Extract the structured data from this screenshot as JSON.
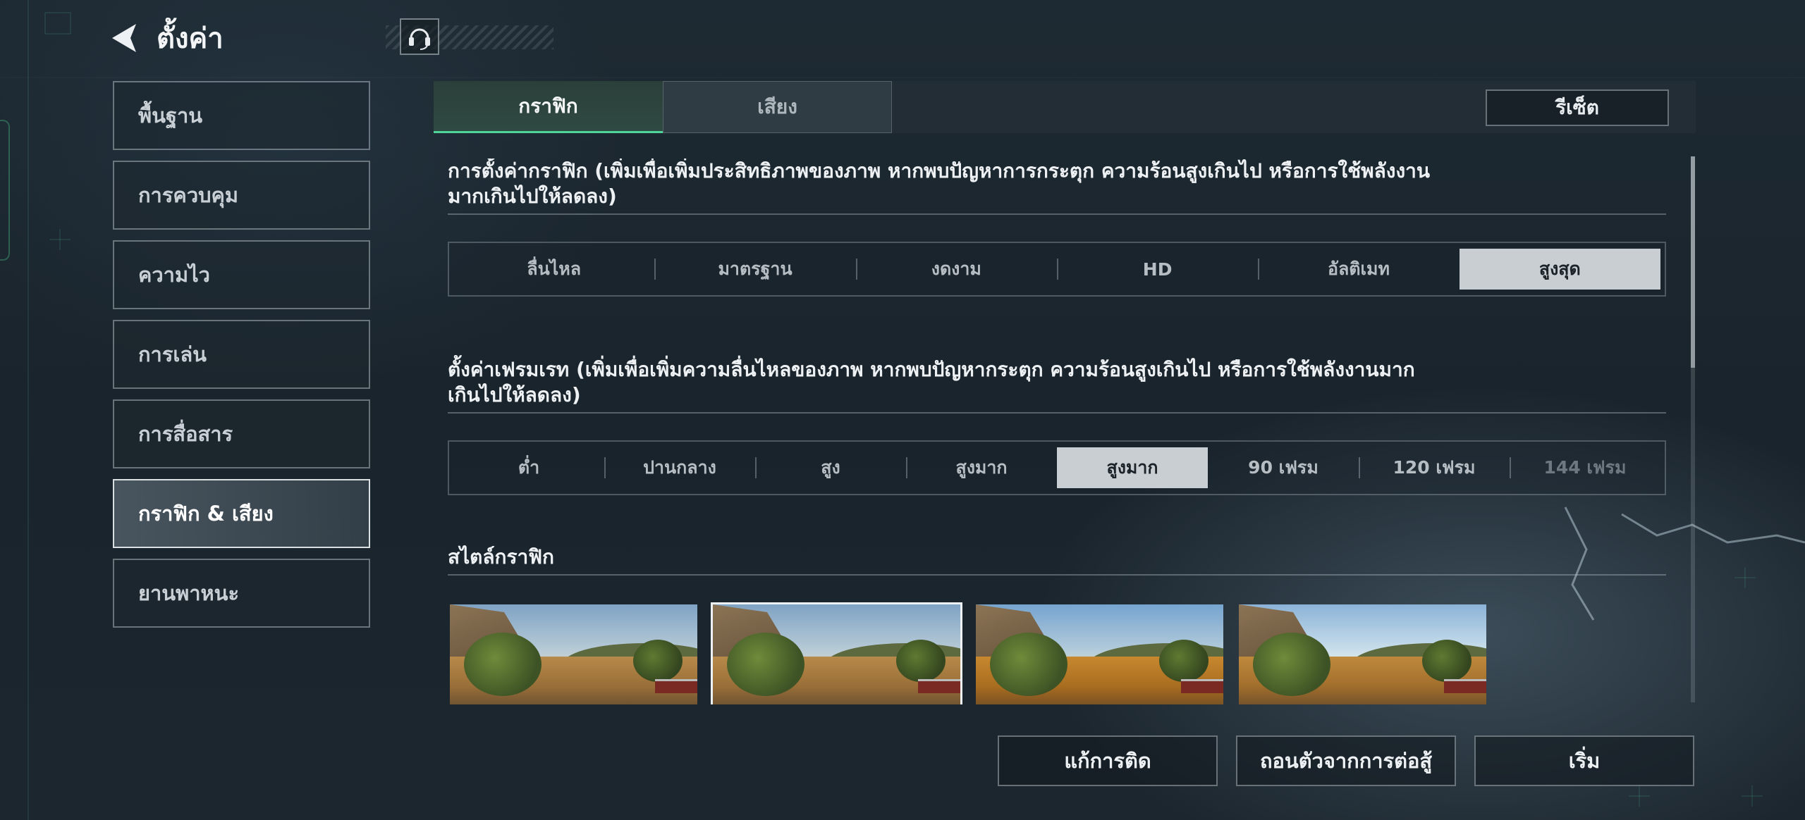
{
  "header": {
    "title": "ตั้งค่า",
    "back_icon": "back-arrow-icon",
    "support_icon": "headset-icon"
  },
  "sidebar": {
    "items": [
      {
        "label": "พื้นฐาน",
        "active": false
      },
      {
        "label": "การควบคุม",
        "active": false
      },
      {
        "label": "ความไว",
        "active": false
      },
      {
        "label": "การเล่น",
        "active": false
      },
      {
        "label": "การสื่อสาร",
        "active": false
      },
      {
        "label": "กราฟิก & เสียง",
        "active": true
      },
      {
        "label": "ยานพาหนะ",
        "active": false
      }
    ]
  },
  "tabs": [
    {
      "label": "กราฟิก",
      "active": true
    },
    {
      "label": "เสียง",
      "active": false
    }
  ],
  "reset_label": "รีเซ็ต",
  "graphics_quality": {
    "title": "การตั้งค่ากราฟิก (เพิ่มเพื่อเพิ่มประสิทธิภาพของภาพ หากพบปัญหาการกระตุก ความร้อนสูงเกินไป หรือการใช้พลังงานมากเกินไปให้ลดลง)",
    "options": [
      "ลื่นไหล",
      "มาตรฐาน",
      "งดงาม",
      "HD",
      "อัลติเมท",
      "สูงสุด"
    ],
    "selected": "สูงสุด"
  },
  "frame_rate": {
    "title": "ตั้งค่าเฟรมเรท (เพิ่มเพื่อเพิ่มความลื่นไหลของภาพ หากพบปัญหากระตุก ความร้อนสูงเกินไป หรือการใช้พลังงานมากเกินไปให้ลดลง)",
    "options": [
      "ต่ำ",
      "ปานกลาง",
      "สูง",
      "สูงมาก",
      "สูงมาก",
      "90 เฟรม",
      "120 เฟรม",
      "144 เฟรม"
    ],
    "selected_index": 4,
    "disabled_index": 7
  },
  "graphics_style": {
    "title": "สไตล์กราฟิก",
    "selected_index": 1
  },
  "footer": {
    "unstuck_label": "แก้การติด",
    "exit_label": "ถอนตัวจากการต่อสู้",
    "start_label": "เริ่ม"
  },
  "colors": {
    "accent": "#4fd59a",
    "selected_bg": "#c9ced2"
  }
}
